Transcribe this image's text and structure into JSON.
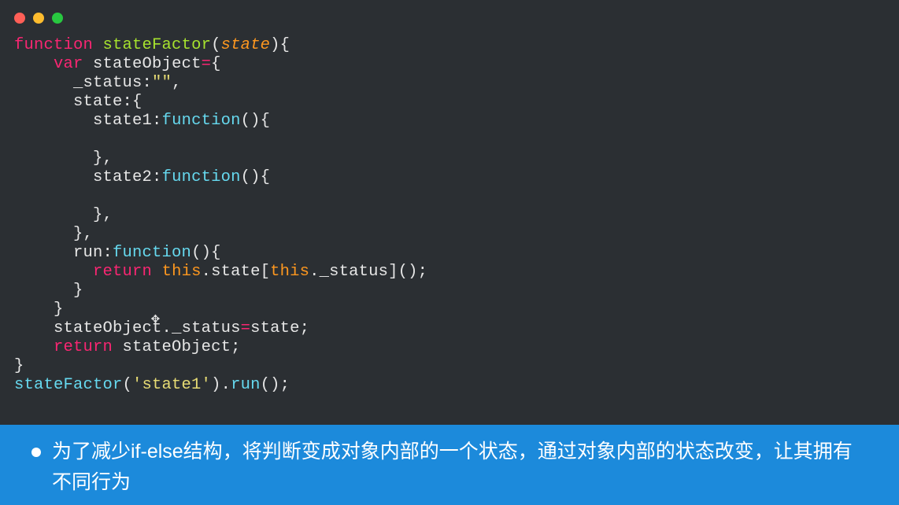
{
  "colors": {
    "editor_bg": "#2b2f33",
    "banner_bg": "#1c8adb",
    "keyword": "#f92672",
    "function": "#66d9ef",
    "identifier": "#a6e22e",
    "param": "#fd971f",
    "string": "#e6db74",
    "plain": "#e6e6e6"
  },
  "traffic": {
    "red": "red",
    "yellow": "yellow",
    "green": "green"
  },
  "code": {
    "l1_kw_function": "function",
    "l1_fn_name": "stateFactor",
    "l1_open": "(",
    "l1_param": "state",
    "l1_close": "){",
    "l2_kw_var": "var",
    "l2_id": "stateObject",
    "l2_rest": "={",
    "l3_prop": "_status",
    "l3_rest1": ":",
    "l3_str": "\"\"",
    "l3_rest2": ",",
    "l4_prop": "state",
    "l4_rest": ":{",
    "l5_prop": "state1",
    "l5_colon": ":",
    "l5_fn": "function",
    "l5_rest": "(){",
    "l6": "",
    "l7_close": "},",
    "l8_prop": "state2",
    "l8_colon": ":",
    "l8_fn": "function",
    "l8_rest": "(){",
    "l9": "",
    "l10_close": "},",
    "l11_close": "},",
    "l12_prop": "run",
    "l12_colon": ":",
    "l12_fn": "function",
    "l12_rest": "(){",
    "l13_kw_return": "return",
    "l13_sp": " ",
    "l13_this1": "this",
    "l13_dot1": ".",
    "l13_state": "state",
    "l13_lb": "[",
    "l13_this2": "this",
    "l13_dot2": ".",
    "l13_status": "_status",
    "l13_rb": "]();",
    "l14_close": "}",
    "l15_close": "}",
    "l16_obj": "stateObject",
    "l16_dot": ".",
    "l16_status": "_status",
    "l16_eq": "=",
    "l16_state": "state",
    "l16_semi": ";",
    "l17_kw_return": "return",
    "l17_sp": " ",
    "l17_obj": "stateObject",
    "l17_semi": ";",
    "l18_close": "}",
    "l19_fn": "stateFactor",
    "l19_open": "(",
    "l19_str": "'state1'",
    "l19_close": ").",
    "l19_run": "run",
    "l19_end": "();"
  },
  "banner": {
    "text": "为了减少if-else结构，将判断变成对象内部的一个状态，通过对象内部的状态改变，让其拥有不同行为"
  },
  "cursor_glyph": "✥"
}
